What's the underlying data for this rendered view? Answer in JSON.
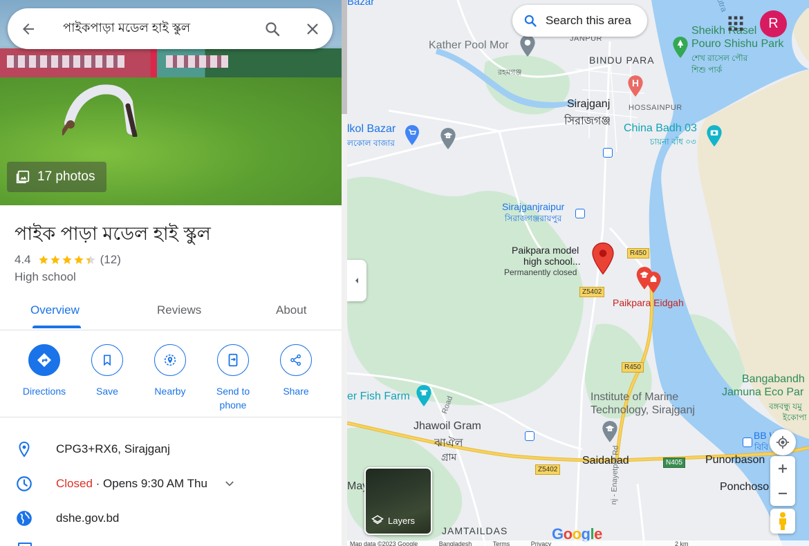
{
  "search": {
    "query": "পাইকপাড়া মডেল হাই স্কুল"
  },
  "hero": {
    "photos_label": "17 photos"
  },
  "place": {
    "title": "পাইক পাড়া মডেল হাই স্কুল",
    "rating": "4.4",
    "rating_value": 4.4,
    "review_count": "(12)",
    "category": "High school"
  },
  "tabs": [
    "Overview",
    "Reviews",
    "About"
  ],
  "actions": {
    "directions": "Directions",
    "save": "Save",
    "nearby": "Nearby",
    "send_line1": "Send to",
    "send_line2": "phone",
    "share": "Share"
  },
  "info": {
    "plus_code": "CPG3+RX6, Sirajganj",
    "status": "Closed",
    "hours": " · Opens 9:30 AM Thu",
    "website": "dshe.gov.bd"
  },
  "map": {
    "search_area": "Search this area",
    "avatar_initial": "R",
    "layers_label": "Layers",
    "google": "Google",
    "labels": {
      "bazar": "Bazar",
      "kather_pool_mor": "Kather Pool Mor",
      "janpur": "JANPUR",
      "bindu_para": "BINDU PARA",
      "rohomgonj": "রহমগঞ্জ",
      "hossainpur": "HOSSAINPUR",
      "sirajganj_en": "Sirajganj",
      "sirajganj_bn": "সিরাজগঞ্জ",
      "kol_bazar": "lkol Bazar",
      "kol_bazar_bn": "লকোল বাজার",
      "china_badh": "China Badh 03",
      "china_badh_bn": "চায়না বাঁধ ০৩",
      "sheikh_rasel_1": "Sheikh Rasel",
      "sheikh_rasel_2": "Pouro Shishu Park",
      "sheikh_rasel_bn_1": "শেখ রাসেল পৌর",
      "sheikh_rasel_bn_2": "শিশু পার্ক",
      "sirajganjraipur": "Sirajganjraipur",
      "sirajganjraipur_bn": "সিরাজগঞ্জরায়পুর",
      "paikpara_1": "Paikpara model",
      "paikpara_2": "high school...",
      "paikpara_3": "Permanently closed",
      "paikpara_eidgah": "Paikpara Eidgah",
      "r450_a": "R450",
      "r450_b": "R450",
      "z5402_a": "Z5402",
      "z5402_b": "Z5402",
      "n405": "N405",
      "fish_farm": "er Fish Farm",
      "road": "Road",
      "jhawoil_1": "Jhawoil Gram",
      "jhawoil_bn_1": "ঝাঐল",
      "jhawoil_bn_2": "গ্রাম",
      "marine_1": "Institute of Marine",
      "marine_2": "Technology, Sirajganj",
      "bangabandhu_1": "Bangabandh",
      "bangabandhu_2": "Jamuna Eco Par",
      "bangabandhu_bn_1": "বঙ্গবন্ধু যমু",
      "bangabandhu_bn_2": "ইকোপা",
      "saidabad": "Saidabad",
      "punorbason": "Punorbason",
      "ponchosona": "Ponchoso",
      "bb_we": "BB   We",
      "bb_bn": "বিবি",
      "jamtaildas": "JAMTAILDAS",
      "may": "May",
      "enayetpur": "nj - Enayetpur Rd",
      "putra": "utra"
    },
    "footer": [
      "Map data ©2023 Google",
      "Bangladesh",
      "Terms",
      "Privacy",
      "2 km"
    ]
  },
  "colors": {
    "accent": "#1a73e8",
    "closed": "#d93025",
    "water": "#9fcdf4",
    "land": "#eceef1",
    "sand": "#eee7d2",
    "green": "#c7e4cc",
    "major_road": "#f7d35e",
    "marker": "#ea4335",
    "avatar": "#d81b60"
  }
}
